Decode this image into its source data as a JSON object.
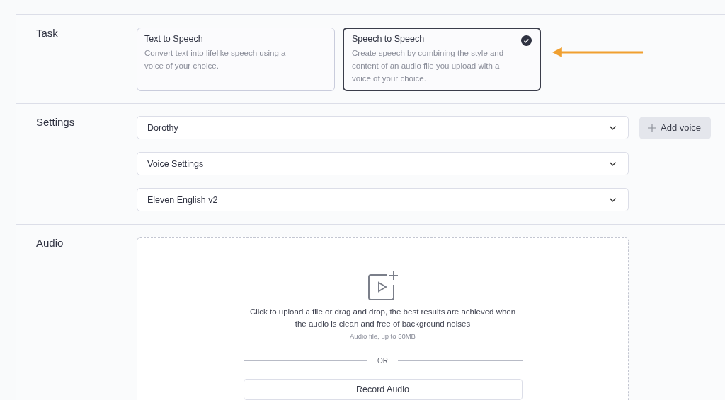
{
  "task": {
    "label": "Task",
    "options": [
      {
        "title": "Text to Speech",
        "description": "Convert text into lifelike speech using a voice of your choice.",
        "selected": false
      },
      {
        "title": "Speech to Speech",
        "description": "Create speech by combining the style and content of an audio file you upload with a voice of your choice.",
        "selected": true
      }
    ]
  },
  "settings": {
    "label": "Settings",
    "dropdowns": [
      {
        "value": "Dorothy"
      },
      {
        "value": "Voice Settings"
      },
      {
        "value": "Eleven English v2"
      }
    ],
    "add_voice_button": "Add voice"
  },
  "audio": {
    "label": "Audio",
    "upload_text": "Click to upload a file or drag and drop, the best results are achieved when the audio is clean and free of background noises",
    "file_hint": "Audio file, up to 50MB",
    "divider_text": "OR",
    "record_button": "Record Audio"
  }
}
